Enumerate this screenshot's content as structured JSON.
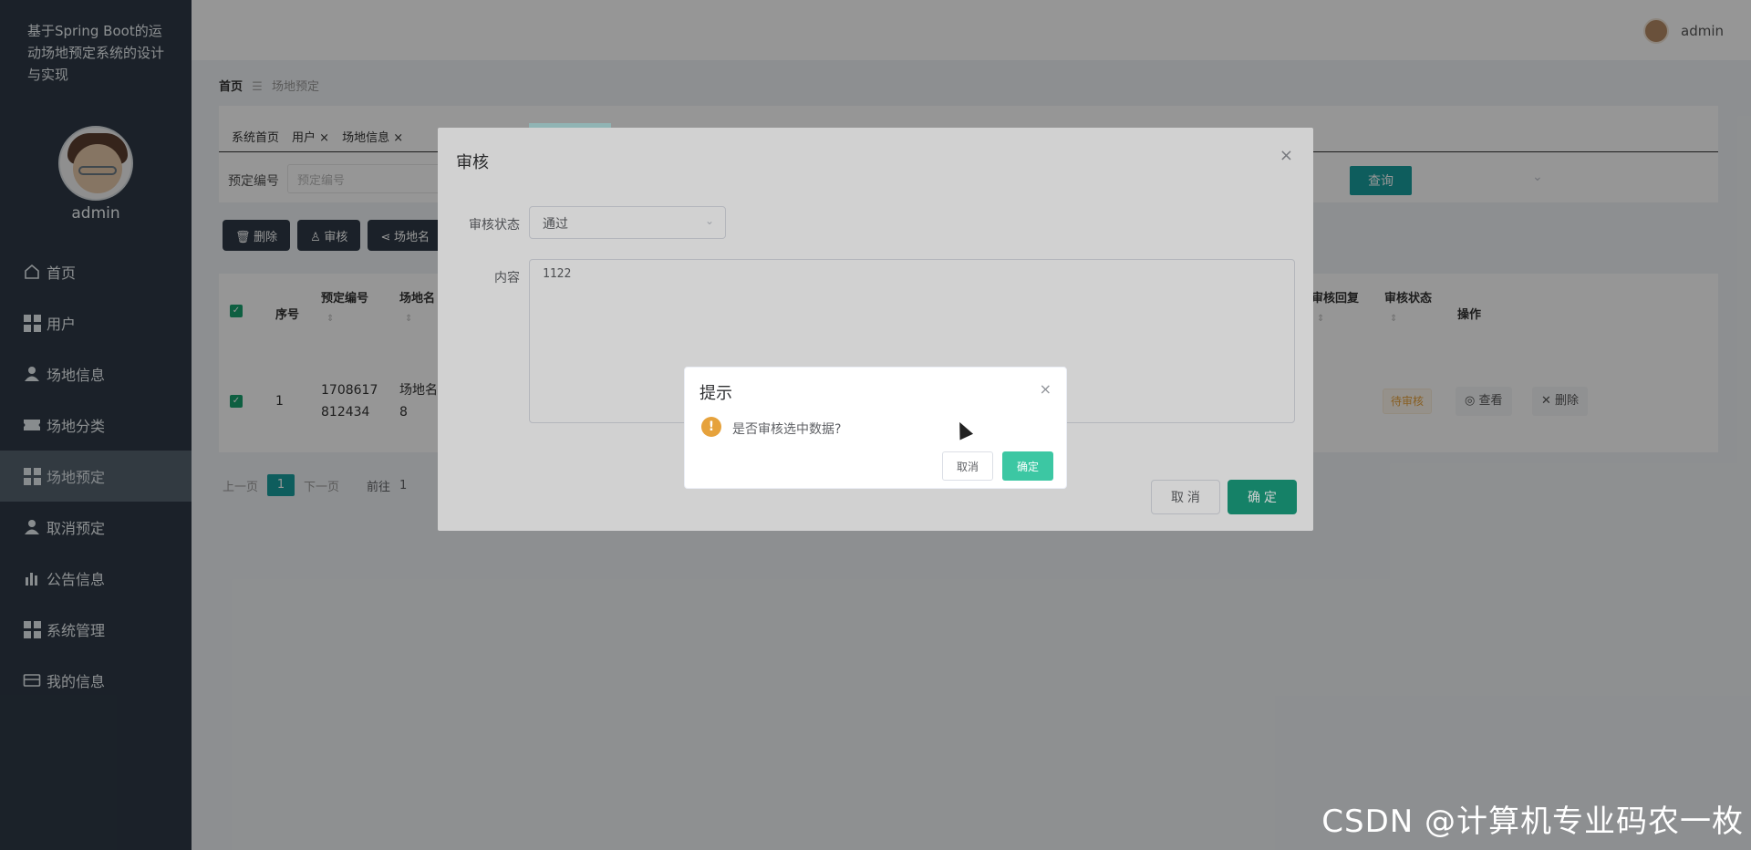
{
  "app": {
    "title": "基于Spring Boot的运动场地预定系统的设计与实现",
    "user": "admin"
  },
  "sidebar": {
    "items": [
      {
        "label": "首页",
        "icon": "home-icon"
      },
      {
        "label": "用户",
        "icon": "grid-icon"
      },
      {
        "label": "场地信息",
        "icon": "user-icon"
      },
      {
        "label": "场地分类",
        "icon": "ticket-icon"
      },
      {
        "label": "场地预定",
        "icon": "grid-icon",
        "active": true
      },
      {
        "label": "取消预定",
        "icon": "user-icon"
      },
      {
        "label": "公告信息",
        "icon": "bar-chart-icon"
      },
      {
        "label": "系统管理",
        "icon": "grid-icon"
      },
      {
        "label": "我的信息",
        "icon": "wallet-icon"
      }
    ]
  },
  "breadcrumb": {
    "home": "首页",
    "separator": "☰",
    "current": "场地预定"
  },
  "tabs": [
    "系统首页",
    "用户",
    "场地信息"
  ],
  "search": {
    "label": "预定编号",
    "placeholder": "预定编号",
    "query_button": "查询"
  },
  "actions": {
    "delete": "删除",
    "audit": "审核",
    "venue": "场地名"
  },
  "table": {
    "headers": {
      "index": "序号",
      "booking_no": "预定编号",
      "venue_name": "场地名",
      "audit_reply": "审核回复",
      "audit_status": "审核状态",
      "operation": "操作"
    },
    "rows": [
      {
        "index": "1",
        "booking_no_line1": "1708617",
        "booking_no_line2": "812434",
        "venue_line1": "场地名",
        "venue_line2": "8",
        "status": "待审核",
        "view": "查看",
        "delete": "删除"
      }
    ]
  },
  "pagination": {
    "prev": "上一页",
    "current": "1",
    "next": "下一页",
    "goto": "前往",
    "goto_value": "1"
  },
  "audit_dialog": {
    "title": "审核",
    "status_label": "审核状态",
    "status_value": "通过",
    "content_label": "内容",
    "content_value": "1122",
    "cancel": "取 消",
    "confirm": "确 定"
  },
  "confirm_box": {
    "title": "提示",
    "message": "是否审核选中数据?",
    "cancel": "取消",
    "confirm": "确定"
  },
  "watermark": "CSDN @计算机专业码农一枚",
  "colors": {
    "sidebar": "#2e3a46",
    "accent": "#1a9e9e",
    "confirm": "#3cc7a3",
    "warning": "#e6a23c"
  }
}
